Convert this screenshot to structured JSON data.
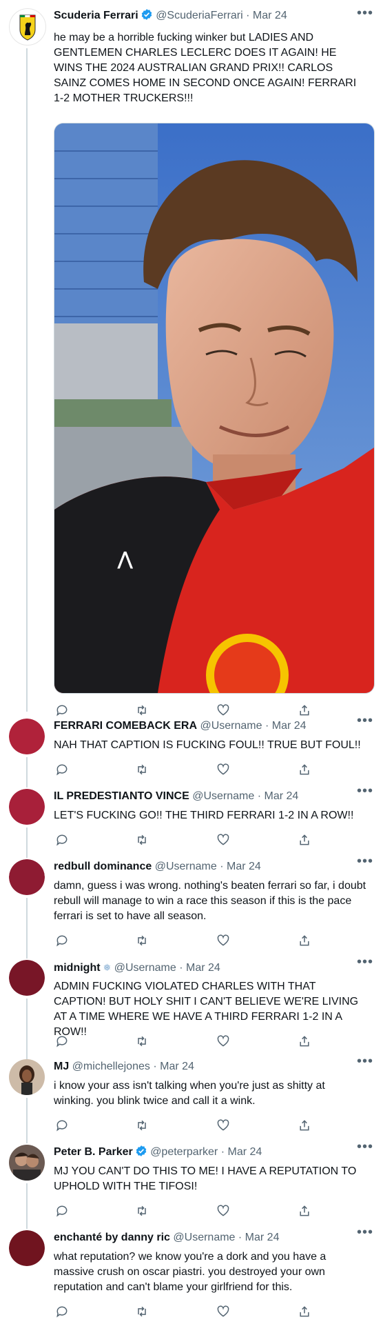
{
  "main_tweet": {
    "name": "Scuderia Ferrari",
    "handle": "@ScuderiaFerrari",
    "sep": "·",
    "date": "Mar 24",
    "more": "•••",
    "text": "he may be a horrible fucking winker but LADIES AND GENTLEMEN CHARLES LECLERC DOES IT AGAIN! HE WINS THE 2024 AUSTRALIAN GRAND PRIX!! CARLOS SAINZ COMES HOME IN SECOND ONCE AGAIN! FERRARI 1-2 MOTHER TRUCKERS!!!"
  },
  "replies": [
    {
      "name": "FERRARI COMEBACK ERA",
      "handle": "@Username",
      "sep": "·",
      "date": "Mar 24",
      "more": "•••",
      "text": "NAH THAT CAPTION IS FUCKING FOUL!! TRUE BUT FOUL!!",
      "avatar_color": "#b0223a"
    },
    {
      "name": "IL PREDESTIANTO VINCE",
      "handle": "@Username",
      "sep": "·",
      "date": "Mar 24",
      "more": "•••",
      "text": "LET'S FUCKING GO!! THE THIRD FERRARI 1-2 IN A ROW!!",
      "avatar_color": "#a8203a"
    },
    {
      "name": "redbull dominance",
      "handle": "@Username",
      "sep": "·",
      "date": "Mar 24",
      "more": "•••",
      "text": "damn, guess i was wrong. nothing's beaten ferrari so far, i doubt rebull will manage to win a race this season if this is the pace ferrari is set to have all season.",
      "avatar_color": "#8e1b32"
    },
    {
      "name": "midnight",
      "handle": "@Username",
      "sep": "·",
      "date": "Mar 24",
      "more": "•••",
      "text": "ADMIN FUCKING VIOLATED CHARLES WITH THAT CAPTION! BUT HOLY SHIT I CAN'T BELIEVE WE'RE LIVING AT A TIME WHERE WE HAVE A THIRD FERRARI 1-2 IN A ROW!!",
      "avatar_color": "#781627"
    },
    {
      "name": "MJ",
      "handle": "@michellejones",
      "sep": "·",
      "date": "Mar 24",
      "more": "•••",
      "text": "i know your ass isn't talking when you're just as shitty at winking. you blink twice and call it a wink.",
      "avatar_color": "#c9b8a6"
    },
    {
      "name": "Peter B. Parker",
      "handle": "@peterparker",
      "sep": "·",
      "date": "Mar 24",
      "more": "•••",
      "text": "MJ YOU CAN'T DO THIS TO ME! I HAVE A REPUTATION TO UPHOLD WITH THE TIFOSI!",
      "avatar_color": "#6b5a52"
    },
    {
      "name": "enchanté by danny ric",
      "handle": "@Username",
      "sep": "·",
      "date": "Mar 24",
      "more": "•••",
      "text": "what reputation? we know you're a dork and you have a massive crush on oscar piastri. you destroyed your own reputation and can't blame your girlfriend for this.",
      "avatar_color": "#70141f"
    }
  ],
  "colors": {
    "text": "#0f1419",
    "muted": "#536471",
    "verified": "#1d9bf0",
    "thread_line": "#cfd9de"
  },
  "icons": [
    "ferrari-shield-icon",
    "verified-badge-icon",
    "more-icon",
    "reply-icon",
    "retweet-icon",
    "like-icon",
    "share-icon"
  ]
}
